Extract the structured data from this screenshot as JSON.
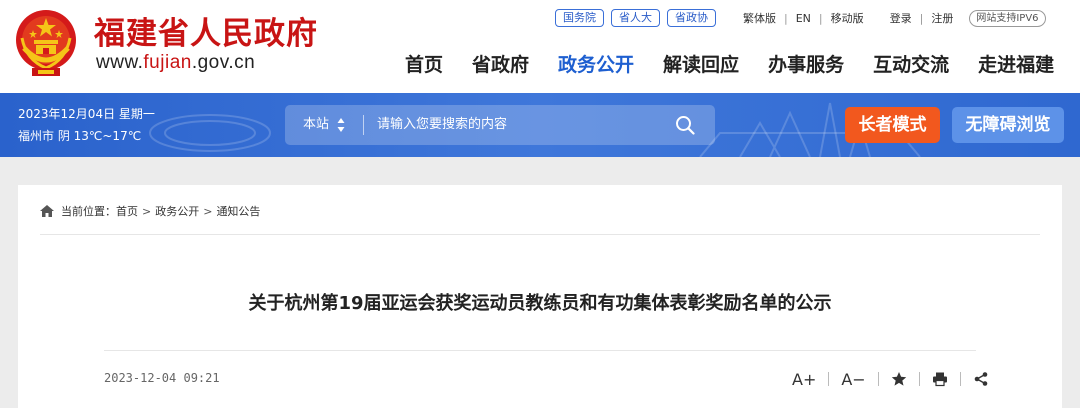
{
  "header": {
    "site_name": "福建省人民政府",
    "url_prefix": "www.",
    "url_highlight": "fujian",
    "url_suffix": ".gov.cn",
    "top_pills": [
      "国务院",
      "省人大",
      "省政协"
    ],
    "top_links": [
      "繁体版",
      "EN",
      "移动版"
    ],
    "login": "登录",
    "register": "注册",
    "ipv6": "网站支持IPV6",
    "nav": [
      "首页",
      "省政府",
      "政务公开",
      "解读回应",
      "办事服务",
      "互动交流",
      "走进福建"
    ],
    "active_nav": "政务公开"
  },
  "bluebar": {
    "date": "2023年12月04日 星期一",
    "weather": "福州市 阴 13℃~17℃",
    "search_scope": "本站",
    "search_placeholder": "请输入您要搜索的内容",
    "elder_mode": "长者模式",
    "accessible": "无障碍浏览"
  },
  "breadcrumb": {
    "prefix": "当前位置：",
    "items": [
      "首页",
      "政务公开",
      "通知公告"
    ]
  },
  "article": {
    "title": "关于杭州第19届亚运会获奖运动员教练员和有功集体表彰奖励名单的公示",
    "date": "2023-12-04 09:21",
    "font_up": "A+",
    "font_down": "A−"
  },
  "colors": {
    "brand_red": "#c81414",
    "nav_active": "#1e5fd0",
    "bar_blue": "#2f68d0",
    "elder_orange": "#f2581e",
    "accessible_blue": "#5d92e8"
  },
  "icons": [
    "national-emblem-icon",
    "search-icon",
    "home-icon",
    "star-icon",
    "print-icon",
    "share-icon",
    "sort-arrow-icon"
  ]
}
